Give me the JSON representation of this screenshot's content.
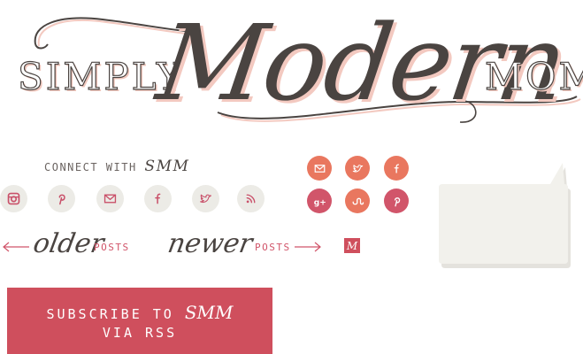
{
  "logo": {
    "left_word": "SIMPLY",
    "script_word": "Modern",
    "right_word": "MOM"
  },
  "connect": {
    "label": "CONNECT WITH ",
    "monogram": "SMM",
    "icons": [
      "instagram-icon",
      "pinterest-icon",
      "mail-icon",
      "facebook-icon",
      "twitter-icon",
      "rss-icon"
    ]
  },
  "share": {
    "icons": [
      {
        "name": "mail-icon",
        "color": "#e9775f"
      },
      {
        "name": "twitter-icon",
        "color": "#e9775f"
      },
      {
        "name": "facebook-icon",
        "color": "#e9775f"
      },
      {
        "name": "google-plus-icon",
        "color": "#d1556a"
      },
      {
        "name": "stumbleupon-icon",
        "color": "#e9775f"
      },
      {
        "name": "pinterest-icon",
        "color": "#d1556a"
      }
    ]
  },
  "nav": {
    "older_script": "older",
    "older_posts": "POSTS",
    "newer_script": "newer",
    "newer_posts": "POSTS",
    "mini_logo": "M"
  },
  "subscribe": {
    "line1_prefix": "SUBSCRIBE TO ",
    "line1_monogram": "SMM",
    "line2": "VIA RSS"
  },
  "colors": {
    "accent": "#cf4f5d",
    "coral": "#e9775f",
    "text": "#4a4441",
    "shadow": "#f3c9c0",
    "icon_bg": "#ecebe6"
  }
}
